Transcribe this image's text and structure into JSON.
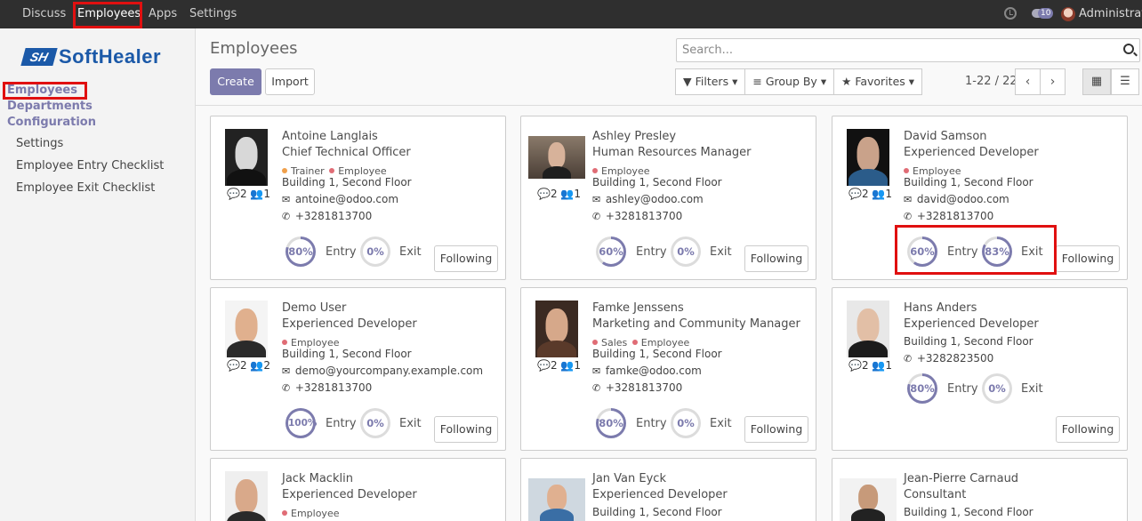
{
  "topbar": {
    "menus": [
      "Discuss",
      "Employees",
      "Apps",
      "Settings"
    ],
    "badge": "10",
    "user": "Administrator"
  },
  "sidebar": {
    "logo_mark": "SH",
    "logo_text": "SoftHealer",
    "headings": [
      "Employees",
      "Departments",
      "Configuration"
    ],
    "config_items": [
      "Settings",
      "Employee Entry Checklist",
      "Employee Exit Checklist"
    ]
  },
  "control": {
    "title": "Employees",
    "create": "Create",
    "import": "Import",
    "search_placeholder": "Search...",
    "filters": "Filters",
    "group_by": "Group By",
    "favorites": "Favorites",
    "pager": "1-22 / 22"
  },
  "labels": {
    "entry": "Entry",
    "exit": "Exit",
    "following": "Following"
  },
  "colors": {
    "accent": "#7c7bad",
    "highlight": "#e01010",
    "tag_trainer": "#f0a04b",
    "tag_employee": "#e06c75"
  },
  "employees": [
    {
      "name": "Antoine Langlais",
      "job": "Chief Technical Officer",
      "tags": [
        "Trainer",
        "Employee"
      ],
      "location": "Building 1, Second Floor",
      "email": "antoine@odoo.com",
      "phone": "+3281813700",
      "messages": "2",
      "followers": "1",
      "entry": "80%",
      "exit": "0%"
    },
    {
      "name": "Ashley Presley",
      "job": "Human Resources Manager",
      "tags": [
        "Employee"
      ],
      "location": "Building 1, Second Floor",
      "email": "ashley@odoo.com",
      "phone": "+3281813700",
      "messages": "2",
      "followers": "1",
      "entry": "60%",
      "exit": "0%"
    },
    {
      "name": "David Samson",
      "job": "Experienced Developer",
      "tags": [
        "Employee"
      ],
      "location": "Building 1, Second Floor",
      "email": "david@odoo.com",
      "phone": "+3281813700",
      "messages": "2",
      "followers": "1",
      "entry": "60%",
      "exit": "83%"
    },
    {
      "name": "Demo User",
      "job": "Experienced Developer",
      "tags": [
        "Employee"
      ],
      "location": "Building 1, Second Floor",
      "email": "demo@yourcompany.example.com",
      "phone": "+3281813700",
      "messages": "2",
      "followers": "2",
      "entry": "100%",
      "exit": "0%"
    },
    {
      "name": "Famke Jenssens",
      "job": "Marketing and Community Manager",
      "tags": [
        "Sales",
        "Employee"
      ],
      "location": "Building 1, Second Floor",
      "email": "famke@odoo.com",
      "phone": "+3281813700",
      "messages": "2",
      "followers": "1",
      "entry": "80%",
      "exit": "0%"
    },
    {
      "name": "Hans Anders",
      "job": "Experienced Developer",
      "tags": [],
      "location": "Building 1, Second Floor",
      "email": "",
      "phone": "+3282823500",
      "messages": "2",
      "followers": "1",
      "entry": "80%",
      "exit": "0%"
    },
    {
      "name": "Jack Macklin",
      "job": "Experienced Developer",
      "tags": [
        "Employee"
      ],
      "location": "",
      "email": "",
      "phone": "",
      "messages": "",
      "followers": "",
      "entry": "",
      "exit": ""
    },
    {
      "name": "Jan Van Eyck",
      "job": "Experienced Developer",
      "tags": [],
      "location": "Building 1, Second Floor",
      "email": "",
      "phone": "",
      "messages": "",
      "followers": "",
      "entry": "",
      "exit": ""
    },
    {
      "name": "Jean-Pierre Carnaud",
      "job": "Consultant",
      "tags": [],
      "location": "Building 1, Second Floor",
      "email": "",
      "phone": "",
      "messages": "",
      "followers": "",
      "entry": "",
      "exit": ""
    }
  ]
}
